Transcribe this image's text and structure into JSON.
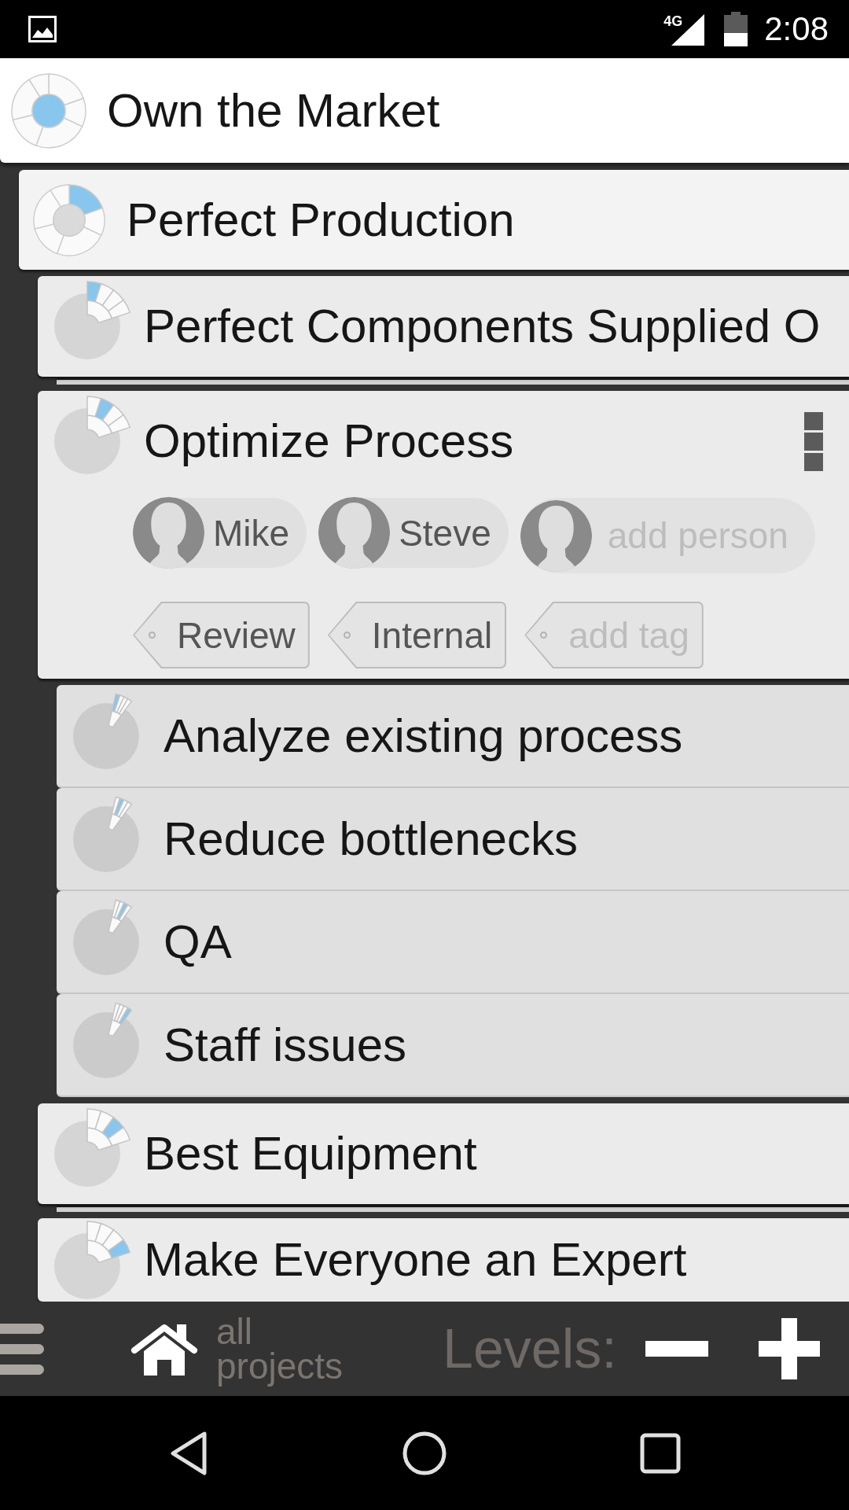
{
  "status_bar": {
    "network": "4G",
    "time": "2:08"
  },
  "root": {
    "title": "Own the Market",
    "indicator": {
      "kind": "ring",
      "center_selected": true,
      "segments": [
        {
          "selected": false
        },
        {
          "selected": false
        },
        {
          "selected": false
        },
        {
          "selected": false
        },
        {
          "selected": false
        },
        {
          "selected": false
        }
      ]
    },
    "children": [
      {
        "title": "Perfect Production",
        "indicator": {
          "kind": "ring",
          "center_selected": false,
          "segments": [
            {
              "selected": true
            },
            {
              "selected": false
            },
            {
              "selected": false
            },
            {
              "selected": false
            },
            {
              "selected": false
            },
            {
              "selected": false
            }
          ]
        },
        "children": [
          {
            "title": "Perfect Components Supplied O",
            "selected": false,
            "collapsed": true,
            "indicator": {
              "kind": "fan",
              "segments": [
                {
                  "selected": true
                },
                {
                  "selected": false
                },
                {
                  "selected": false
                },
                {
                  "selected": false
                }
              ]
            }
          },
          {
            "title": "Optimize Process",
            "selected": true,
            "collapsed": false,
            "indicator": {
              "kind": "fan",
              "segments": [
                {
                  "selected": false
                },
                {
                  "selected": true
                },
                {
                  "selected": false
                },
                {
                  "selected": false
                }
              ]
            },
            "people": [
              {
                "kind": "person",
                "name": "Mike"
              },
              {
                "kind": "person",
                "name": "Steve"
              },
              {
                "kind": "add",
                "name": "add person"
              }
            ],
            "tags": [
              {
                "kind": "tag",
                "label": "Review"
              },
              {
                "kind": "tag",
                "label": "Internal"
              },
              {
                "kind": "add",
                "label": "add tag"
              }
            ],
            "children": [
              {
                "title": "Analyze existing process",
                "indicator": {
                  "kind": "narrow-fan",
                  "segments": [
                    {
                      "selected": true
                    },
                    {
                      "selected": false
                    },
                    {
                      "selected": false
                    },
                    {
                      "selected": false
                    }
                  ]
                }
              },
              {
                "title": "Reduce bottlenecks",
                "indicator": {
                  "kind": "narrow-fan",
                  "segments": [
                    {
                      "selected": false
                    },
                    {
                      "selected": true
                    },
                    {
                      "selected": false
                    },
                    {
                      "selected": false
                    }
                  ]
                }
              },
              {
                "title": "QA",
                "indicator": {
                  "kind": "narrow-fan",
                  "segments": [
                    {
                      "selected": false
                    },
                    {
                      "selected": false
                    },
                    {
                      "selected": true
                    },
                    {
                      "selected": false
                    }
                  ]
                }
              },
              {
                "title": "Staff issues",
                "indicator": {
                  "kind": "narrow-fan",
                  "segments": [
                    {
                      "selected": false
                    },
                    {
                      "selected": false
                    },
                    {
                      "selected": false
                    },
                    {
                      "selected": true
                    }
                  ]
                }
              }
            ]
          },
          {
            "title": "Best Equipment",
            "selected": false,
            "collapsed": true,
            "indicator": {
              "kind": "fan",
              "segments": [
                {
                  "selected": false
                },
                {
                  "selected": false
                },
                {
                  "selected": true
                },
                {
                  "selected": false
                }
              ]
            }
          },
          {
            "title": "Make Everyone an Expert",
            "selected": false,
            "collapsed": false,
            "indicator": {
              "kind": "fan",
              "segments": [
                {
                  "selected": false
                },
                {
                  "selected": false
                },
                {
                  "selected": false
                },
                {
                  "selected": true
                }
              ]
            }
          }
        ]
      }
    ]
  },
  "bottom_bar": {
    "home_label": "all projects",
    "levels_label": "Levels:"
  }
}
